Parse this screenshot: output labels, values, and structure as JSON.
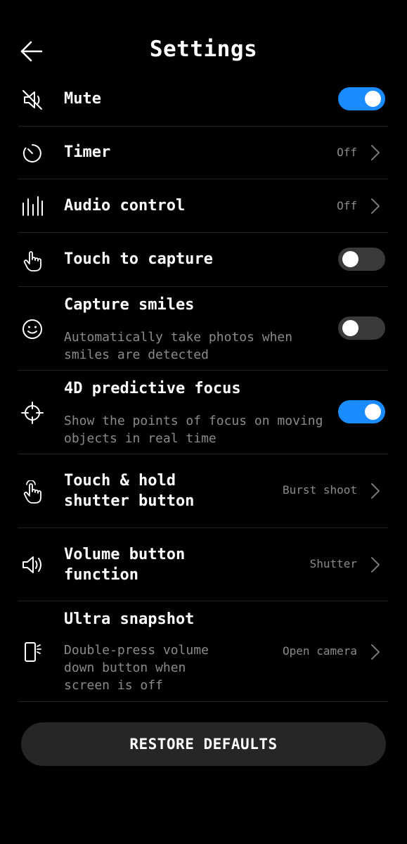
{
  "header": {
    "title": "Settings"
  },
  "settings": {
    "mute": {
      "label": "Mute",
      "enabled": true
    },
    "timer": {
      "label": "Timer",
      "value": "Off"
    },
    "audio_control": {
      "label": "Audio control",
      "value": "Off"
    },
    "touch_to_capture": {
      "label": "Touch to capture",
      "enabled": false
    },
    "capture_smiles": {
      "label": "Capture smiles",
      "description_line1": "Automatically take photos when",
      "description_line2": "smiles are detected",
      "enabled": false
    },
    "predictive_focus": {
      "label": "4D predictive focus",
      "description_line1": "Show the points of focus on moving",
      "description_line2": "objects in real time",
      "enabled": true
    },
    "touch_hold_shutter": {
      "label_line1": "Touch & hold",
      "label_line2": "shutter button",
      "value": "Burst shoot"
    },
    "volume_button": {
      "label_line1": "Volume button",
      "label_line2": "function",
      "value": "Shutter"
    },
    "ultra_snapshot": {
      "label": "Ultra snapshot",
      "description_line1": "Double-press volume",
      "description_line2": "down button when",
      "description_line3": "screen is off",
      "value": "Open camera"
    }
  },
  "footer": {
    "restore_label": "RESTORE DEFAULTS"
  },
  "colors": {
    "background": "#000000",
    "toggle_on": "#1a8cff",
    "toggle_off": "#3a3a3a",
    "secondary_text": "#8a8a8a",
    "button_bg": "#262626"
  },
  "icons": {
    "back": "arrow-left-icon",
    "mute": "speaker-muted-icon",
    "timer": "timer-icon",
    "audio": "audio-bars-icon",
    "touch": "hand-tap-icon",
    "smile": "smiley-icon",
    "focus": "crosshair-icon",
    "hold": "hand-press-icon",
    "volume": "speaker-icon",
    "snapshot": "phone-flash-icon",
    "chevron": "chevron-right-icon"
  }
}
